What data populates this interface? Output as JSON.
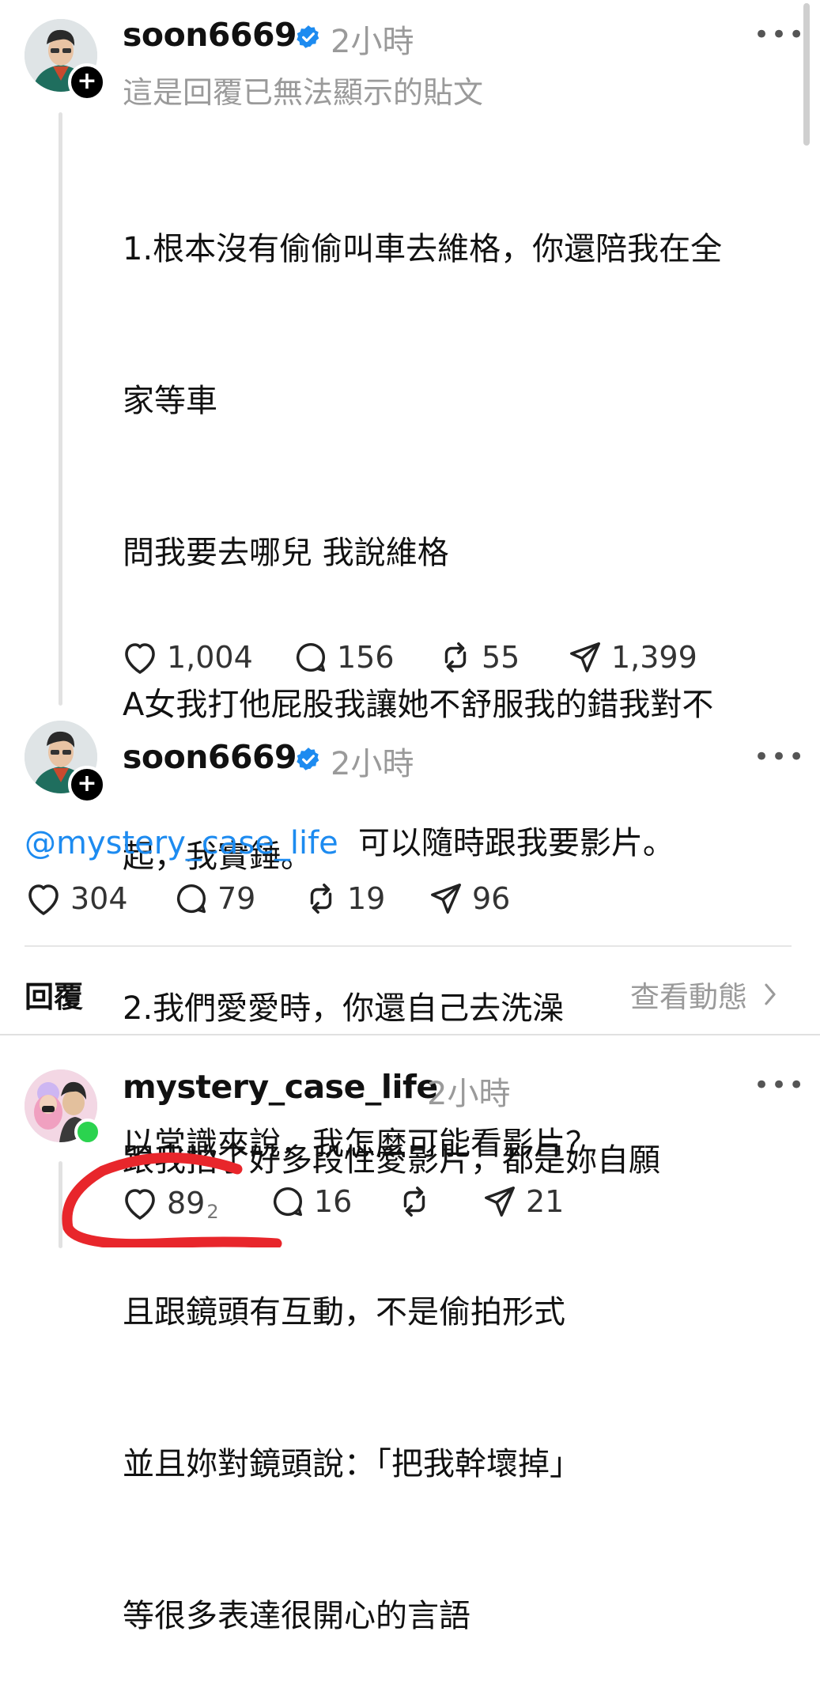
{
  "post1": {
    "username": "soon6669",
    "time": "2小時",
    "subtitle": "這是回覆已無法顯示的貼文",
    "more_icon": "more-horizontal-icon",
    "body_lines": [
      "1.根本沒有偷偷叫車去維格，你還陪我在全",
      "家等車",
      "問我要去哪兒 我說維格",
      "A女我打他屁股我讓她不舒服我的錯我對不",
      "起，我實錘。",
      "2.我們愛愛時，你還自己去洗澡",
      "跟我拍了好多段性愛影片，都是妳自願",
      "且跟鏡頭有互動，不是偷拍形式",
      "並且妳對鏡頭說：「把我幹壞掉」",
      "等很多表達很開心的言語"
    ],
    "likes": "1,004",
    "comments": "156",
    "reposts": "55",
    "shares": "1,399"
  },
  "post2": {
    "username": "soon6669",
    "time": "2小時",
    "mention": "@mystery_case_life",
    "text": "可以隨時跟我要影片。",
    "likes": "304",
    "comments": "79",
    "reposts": "19",
    "shares": "96"
  },
  "replies_bar": {
    "label": "回覆",
    "activity_link": "查看動態"
  },
  "reply1": {
    "username": "mystery_case_life",
    "time": "2小時",
    "text": "以常識來說，我怎麼可能看影片？",
    "likes": "89",
    "likes_suffix": "2",
    "comments": "16",
    "reposts": "",
    "shares": "21"
  },
  "colors": {
    "verified_blue": "#1d8bf0",
    "mention_blue": "#1d8bf0",
    "online_green": "#2bd34f",
    "annotation_red": "#e8262b"
  }
}
